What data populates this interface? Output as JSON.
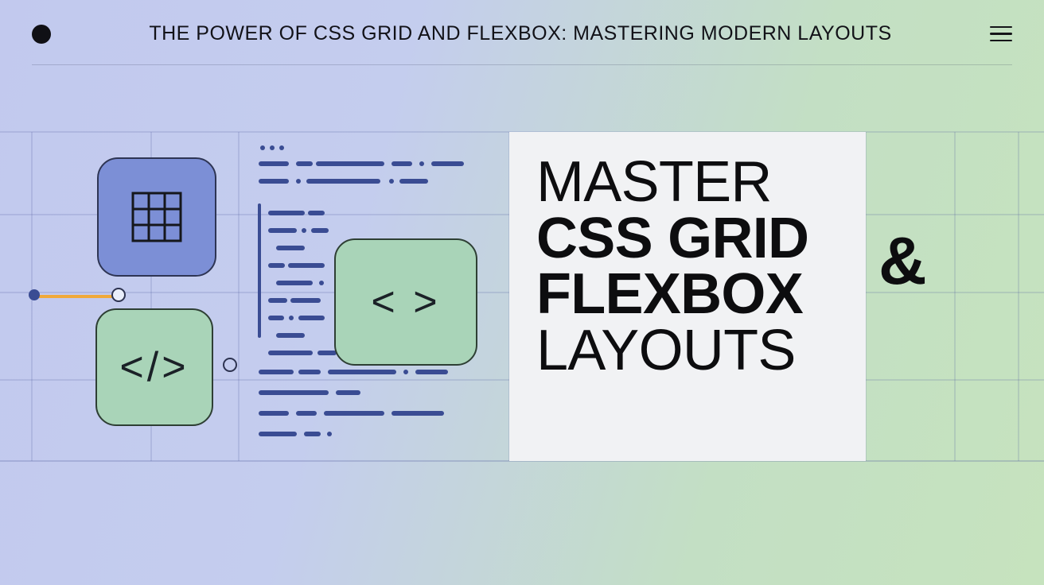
{
  "header": {
    "title": "THE POWER OF CSS GRID AND FLEXBOX: MASTERING MODERN LAYOUTS"
  },
  "hero": {
    "line1": "MASTER",
    "line2": "CSS GRID",
    "line3": "FLEXBOX",
    "line4": "LAYOUTS",
    "amp": "&"
  },
  "glyphs": {
    "code_close": "</>",
    "code_angles": "< >"
  },
  "colors": {
    "accent_purple": "#7c8fd6",
    "accent_green": "#a9d4b8",
    "slider_orange": "#f0a93a"
  }
}
